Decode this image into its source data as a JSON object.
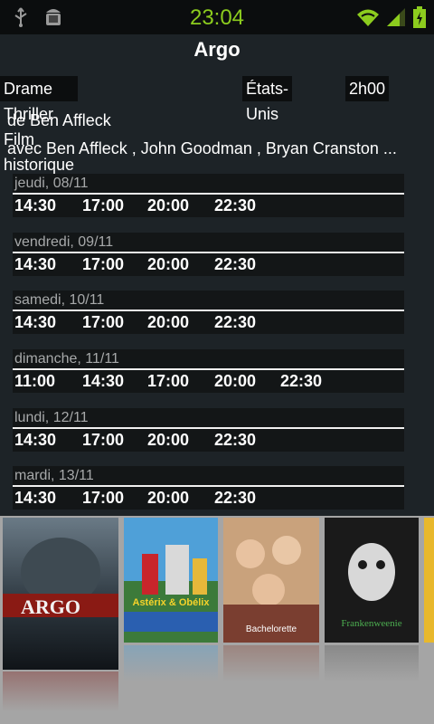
{
  "status": {
    "time": "23:04"
  },
  "movie": {
    "title": "Argo",
    "genres": "Drame Thriller Film historique",
    "country": "États-Unis",
    "duration": "2h00",
    "director": "de Ben Affleck",
    "cast": "avec Ben Affleck , John Goodman , Bryan Cranston ..."
  },
  "showtimes": [
    {
      "day": "jeudi, 08/11",
      "times": [
        "14:30",
        "17:00",
        "20:00",
        "22:30"
      ]
    },
    {
      "day": "vendredi, 09/11",
      "times": [
        "14:30",
        "17:00",
        "20:00",
        "22:30"
      ]
    },
    {
      "day": "samedi, 10/11",
      "times": [
        "14:30",
        "17:00",
        "20:00",
        "22:30"
      ]
    },
    {
      "day": "dimanche, 11/11",
      "times": [
        "11:00",
        "14:30",
        "17:00",
        "20:00",
        "22:30"
      ]
    },
    {
      "day": "lundi, 12/11",
      "times": [
        "14:30",
        "17:00",
        "20:00",
        "22:30"
      ]
    },
    {
      "day": "mardi, 13/11",
      "times": [
        "14:30",
        "17:00",
        "20:00",
        "22:30"
      ]
    }
  ],
  "posters": [
    {
      "name": "argo-poster",
      "title": "ARGO",
      "colors": [
        "#7a1410",
        "#1a2a36"
      ]
    },
    {
      "name": "asterix-poster",
      "title": "Astérix & Obélix",
      "colors": [
        "#4fa0d8",
        "#c8252b"
      ]
    },
    {
      "name": "bachelorette-poster",
      "title": "Bachelorette",
      "colors": [
        "#d7b38a",
        "#8b4a3a"
      ]
    },
    {
      "name": "frankenweenie-poster",
      "title": "Frankenweenie",
      "colors": [
        "#d8d8d8",
        "#222222"
      ]
    },
    {
      "name": "next-poster",
      "title": "",
      "colors": [
        "#e8b82c",
        "#6a4a1a"
      ]
    }
  ]
}
